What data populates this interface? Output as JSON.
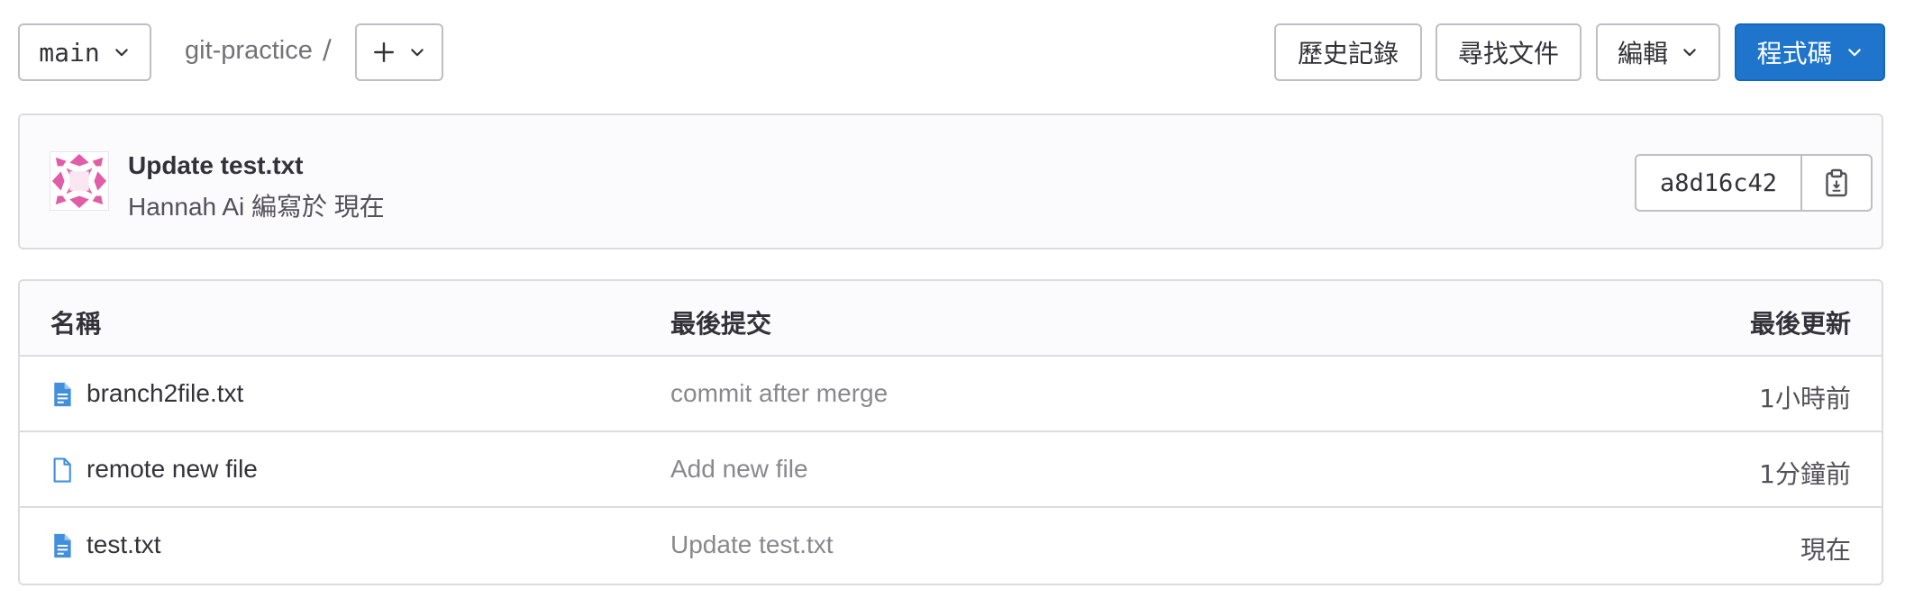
{
  "nav": {
    "branch": "main",
    "project": "git-practice",
    "separator": "/",
    "add_label": "+",
    "history_label": "歷史記錄",
    "find_file_label": "尋找文件",
    "edit_label": "編輯",
    "code_label": "程式碼"
  },
  "commit": {
    "title": "Update test.txt",
    "meta": "Hannah Ai 編寫於 現在",
    "sha": "a8d16c42"
  },
  "table": {
    "headers": {
      "name": "名稱",
      "last_commit": "最後提交",
      "last_update": "最後更新"
    },
    "rows": [
      {
        "name": "branch2file.txt",
        "commit": "commit after merge",
        "updated": "1小時前",
        "icon": "file-text-icon"
      },
      {
        "name": "remote new file",
        "commit": "Add new file",
        "updated": "1分鐘前",
        "icon": "file-icon"
      },
      {
        "name": "test.txt",
        "commit": "Update test.txt",
        "updated": "現在",
        "icon": "file-text-icon"
      }
    ]
  },
  "colors": {
    "primary": "#1f75cb",
    "icon_blue": "#428fdc",
    "avatar_pink": "#e05da8",
    "border": "#dcdcde"
  }
}
